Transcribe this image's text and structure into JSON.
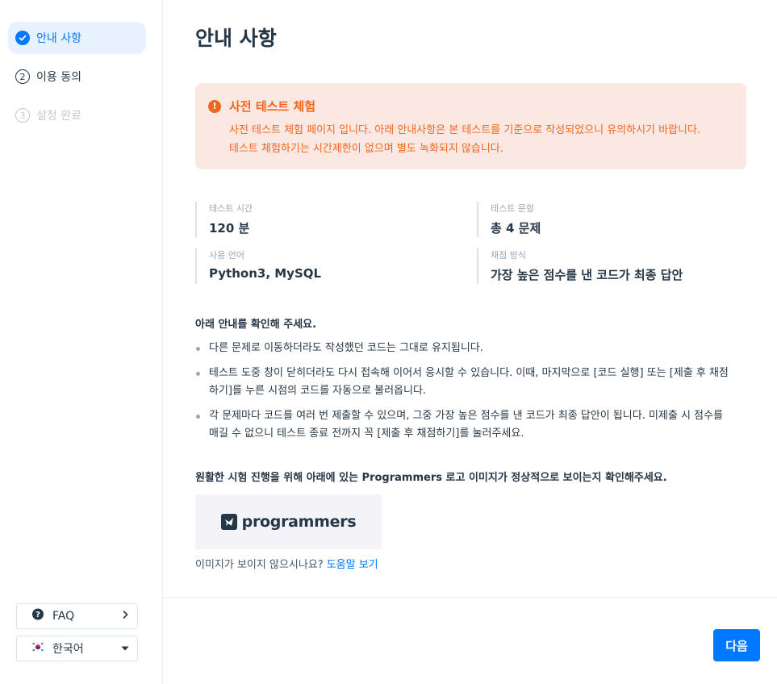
{
  "sidebar": {
    "steps": [
      {
        "num": "✓",
        "label": "안내 사항",
        "state": "active"
      },
      {
        "num": "2",
        "label": "이용 동의",
        "state": "todo"
      },
      {
        "num": "3",
        "label": "설정 완료",
        "state": "disabled"
      }
    ],
    "faq_label": "FAQ",
    "language_label": "한국어"
  },
  "main": {
    "title": "안내 사항",
    "alert": {
      "title": "사전 테스트 체험",
      "line1": "사전 테스트 체험 페이지 입니다. 아래 안내사항은 본 테스트를 기준으로 작성되었으니 유의하시기 바랍니다.",
      "line2": "테스트 체험하기는 시간제한이 없으며 별도 녹화되지 않습니다."
    },
    "info": [
      {
        "key": "테스트 시간",
        "value": "120 분"
      },
      {
        "key": "테스트 문항",
        "value": "총 4 문제"
      },
      {
        "key": "사용 언어",
        "value": "Python3, MySQL"
      },
      {
        "key": "채점 방식",
        "value": "가장 높은 점수를 낸 코드가 최종 답안"
      }
    ],
    "notice_title": "아래 안내를 확인해 주세요.",
    "notices": [
      "다른 문제로 이동하더라도 작성했던 코드는 그대로 유지됩니다.",
      "테스트 도중 창이 닫히더라도 다시 접속해 이어서 응시할 수 있습니다. 이때, 마지막으로 [코드 실행] 또는 [제출 후 채점하기]를 누른 시점의 코드를 자동으로 불러옵니다.",
      "각 문제마다 코드를 여러 번 제출할 수 있으며, 그중 가장 높은 점수를 낸 코드가 최종 답안이 됩니다. 미제출 시 점수를 매길 수 없으니 테스트 종료 전까지 꼭 [제출 후 채점하기]를 눌러주세요."
    ],
    "logo_title": "원활한 시험 진행을 위해 아래에 있는 Programmers 로고 이미지가 정상적으로 보이는지 확인해주세요.",
    "logo_word": "programmers",
    "help_text": "이미지가 보이지 않으시나요?",
    "help_link": "도움말 보기",
    "next_label": "다음"
  },
  "colors": {
    "accent": "#0078ff",
    "warning": "#f0661a",
    "warning_bg": "#fce8e3",
    "text": "#263747"
  }
}
